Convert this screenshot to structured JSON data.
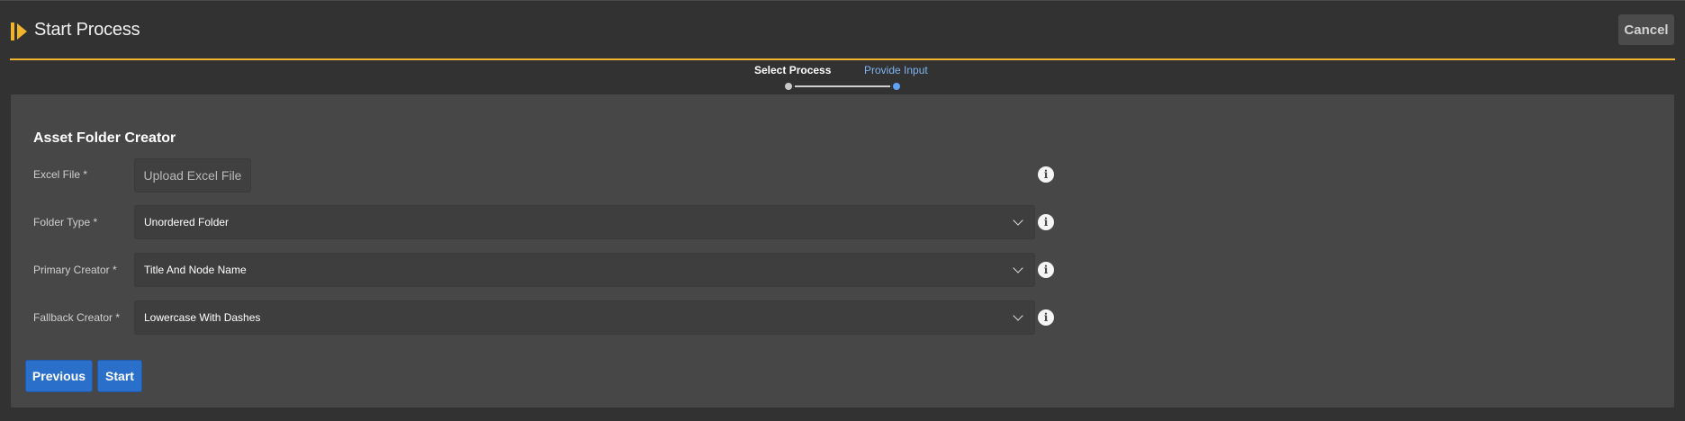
{
  "header": {
    "title": "Start Process",
    "cancel_label": "Cancel"
  },
  "stepper": {
    "steps": [
      {
        "label": "Select Process",
        "state": "completed"
      },
      {
        "label": "Provide Input",
        "state": "active"
      }
    ]
  },
  "form": {
    "title": "Asset Folder Creator",
    "fields": [
      {
        "label": "Excel File *",
        "type": "upload",
        "button_label": "Upload Excel File",
        "info_icon": "info-icon"
      },
      {
        "label": "Folder Type *",
        "type": "select",
        "value": "Unordered Folder",
        "info_icon": "info-icon"
      },
      {
        "label": "Primary Creator *",
        "type": "select",
        "value": "Title And Node Name",
        "info_icon": "info-icon"
      },
      {
        "label": "Fallback Creator *",
        "type": "select",
        "value": "Lowercase With Dashes",
        "info_icon": "info-icon"
      }
    ],
    "info_glyph": "i"
  },
  "actions": {
    "previous_label": "Previous",
    "start_label": "Start"
  },
  "colors": {
    "accent": "#f0b52c",
    "primary_button": "#2a6fc9",
    "active_step": "#7eb2f0"
  }
}
